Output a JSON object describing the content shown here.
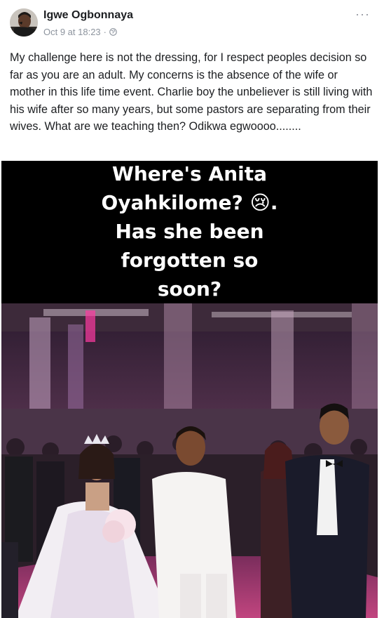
{
  "post": {
    "author": "Igwe Ogbonnaya",
    "timestamp": "Oct 9 at 18:23",
    "separator": "·",
    "more_label": "···",
    "text": "My challenge here is not the dressing, for I respect peoples decision so far as you are an adult. My concerns is the absence of the wife or mother in this life time event. Charlie boy the unbeliever is still living with his wife after so many years, but some pastors are separating from their wives. What are we teaching then? Odikwa egwoooo........"
  },
  "image": {
    "banner_lines": [
      "Where's Anita",
      "Oyahkilome? 😢.",
      "Has she been",
      "forgotten so",
      "soon?"
    ]
  },
  "icons": {
    "globe": "globe-icon",
    "more": "more-options-icon",
    "avatar": "profile-avatar"
  },
  "colors": {
    "text": "#1c1e21",
    "meta": "#8d949e",
    "banner_bg": "#000000",
    "banner_text": "#ffffff"
  }
}
